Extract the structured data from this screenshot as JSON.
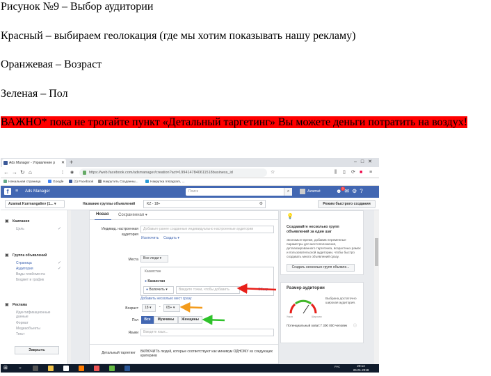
{
  "document": {
    "lines": [
      "Рисунок №9 – Выбор аудитории",
      "Красный – выбираем геолокация (где мы хотим показывать нашу рекламу)",
      "Оранжевая – Возраст",
      "Зеленая – Пол"
    ],
    "warning": "ВАЖНО* пока не трогайте пункт «Детальный таргетинг» Вы можете деньги потратить на воздух!",
    "warning_color": "#ff0000"
  },
  "browser": {
    "tab_title": "Ads Manager - Управление р",
    "url": "https://web.facebook.com/adsmanager/creation?act=1994147840611518business_id",
    "bookmarks": [
      "Начальная страница",
      "Google",
      "(1) Facebook",
      "Накрутить Созданны...",
      "Накрутка Instagram, ..."
    ]
  },
  "fb": {
    "app_title": "Ads Manager",
    "search_placeholder": "Поиск",
    "user_name": "Azamat",
    "notif_count": "2",
    "account": "Azamat Kurmangaliev (1...",
    "group_name_label": "Название группы объявлений",
    "group_name_value": "KZ - 18+",
    "quick_create": "Режим быстрого создания"
  },
  "leftnav": {
    "campaign": "Кампания",
    "campaign_goal": "Цель",
    "adset": "Группа объявлений",
    "adset_items": [
      "Страница",
      "Аудитория",
      "Виды плейсмента",
      "Бюджет и график"
    ],
    "ad": "Реклама",
    "ad_items": [
      "Идентификационные данные",
      "Формат",
      "Медиаобъекты",
      "Текст"
    ],
    "close": "Закрыть"
  },
  "main": {
    "tab_new": "Новая",
    "tab_saved": "Сохраненная",
    "custom_audience_label": "Индивид. настроенная аудитория",
    "custom_audience_placeholder": "Добавьте ранее созданные индивидуально настроенные аудитории",
    "exclude": "Исключить",
    "create": "Создать",
    "places_label": "Места",
    "all_people": "Все люди",
    "country_region": "Казахстан",
    "country": "Казахстан",
    "include": "Включить",
    "place_placeholder": "Введите точки, чтобы добавить",
    "view": "Обзор",
    "add_places": "Добавить несколько мест сразу",
    "age_label": "Возраст",
    "age_min": "18",
    "age_dash": "-",
    "age_max": "65+",
    "gender_label": "Пол",
    "gender_all": "Все",
    "gender_male": "Мужчины",
    "gender_female": "Женщины",
    "lang_label": "Языки",
    "lang_placeholder": "Введите язык...",
    "detailed_label": "Детальный таргетинг",
    "detailed_text": "ВКЛЮЧИТЬ людей, которые соответствуют как минимум ОДНОМУ из следующих критериев"
  },
  "right": {
    "tip_title": "Создавайте несколько групп объявлений за один шаг",
    "tip_text": "Экономьте время, добавив переменные параметры для местоположения, детализированного таргетинга, возрастных рамок и пользовательской аудитории, чтобы быстро создавать много объявлений сразу.",
    "tip_button": "Создать несколько групп объявле...",
    "size_title": "Размер аудитории",
    "gauge_left": "Узкая",
    "gauge_right": "Широкая",
    "gauge_verdict": "Выбрана достаточно широкая аудитория.",
    "reach": "Потенциальный охват:7 300 000 человек"
  },
  "taskbar": {
    "time": "20:14",
    "date": "26.01.2019",
    "lang": "РУС"
  },
  "arrows": {
    "red": "#e8201a",
    "orange": "#f39b1b",
    "green": "#2fc22b"
  }
}
